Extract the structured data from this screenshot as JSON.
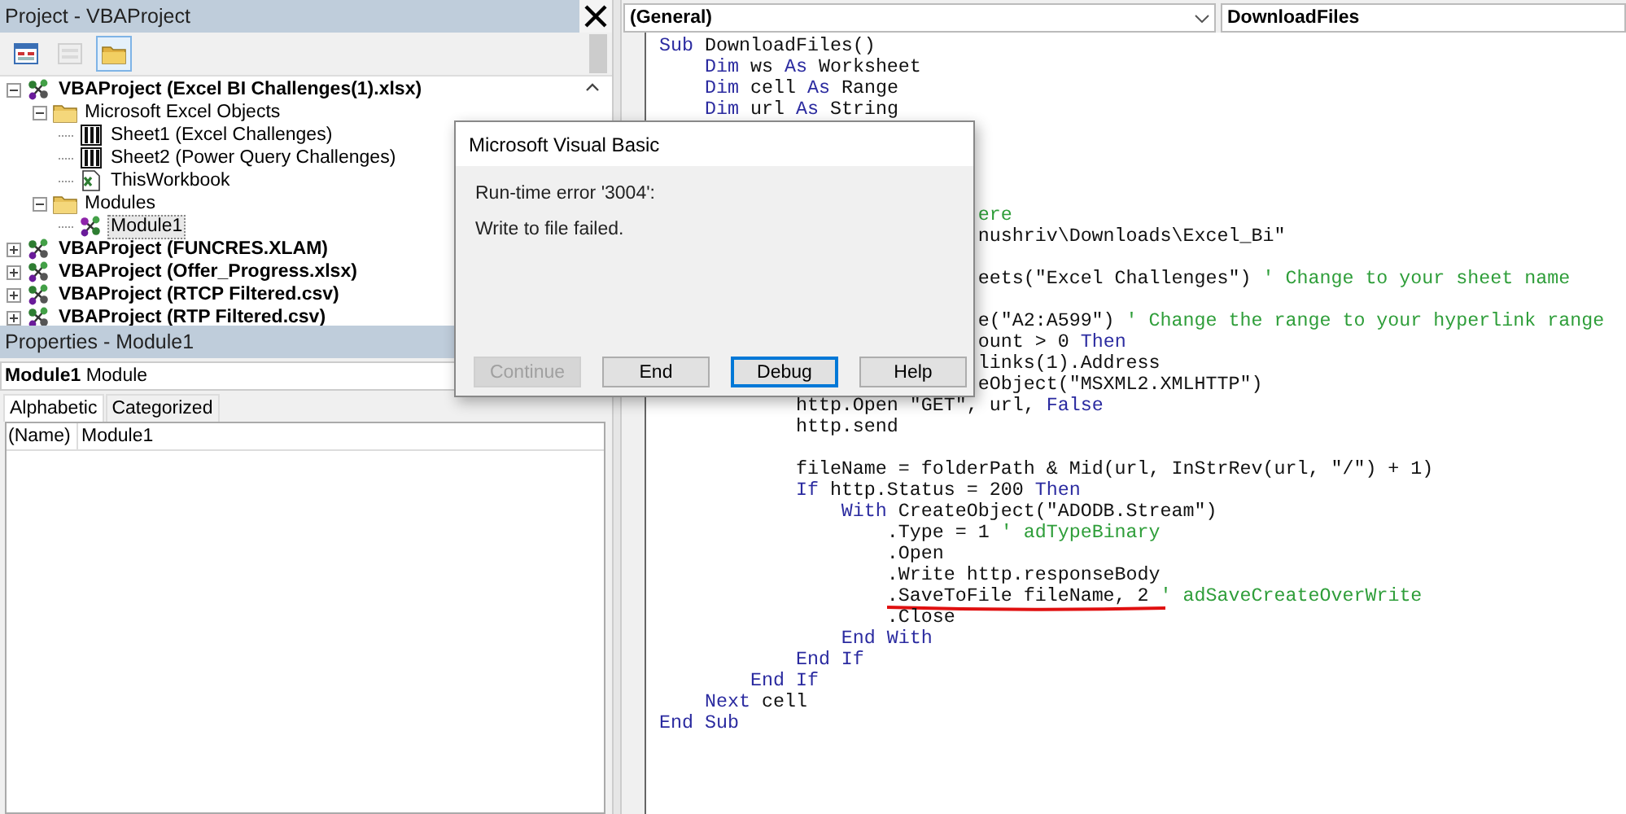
{
  "project_panel": {
    "title": "Project - VBAProject",
    "toolbar": [
      {
        "kind": "code",
        "selected": false,
        "disabled": false
      },
      {
        "kind": "object",
        "selected": false,
        "disabled": true
      },
      {
        "kind": "folders",
        "selected": true,
        "disabled": false
      }
    ],
    "tree": [
      {
        "kind": "project",
        "label": "VBAProject (Excel BI Challenges(1).xlsx)",
        "expanded": true,
        "selected": false,
        "children": [
          {
            "kind": "folder",
            "label": "Microsoft Excel Objects",
            "expanded": true,
            "selected": false,
            "children": [
              {
                "kind": "sheet",
                "label": "Sheet1 (Excel Challenges)",
                "selected": false
              },
              {
                "kind": "sheet",
                "label": "Sheet2 (Power Query Challenges)",
                "selected": false
              },
              {
                "kind": "workbook",
                "label": "ThisWorkbook",
                "selected": false
              }
            ]
          },
          {
            "kind": "folder",
            "label": "Modules",
            "expanded": true,
            "selected": false,
            "children": [
              {
                "kind": "module",
                "label": "Module1",
                "selected": true
              }
            ]
          }
        ]
      },
      {
        "kind": "project",
        "label": "VBAProject (FUNCRES.XLAM)",
        "expanded": false,
        "selected": false
      },
      {
        "kind": "project",
        "label": "VBAProject (Offer_Progress.xlsx)",
        "expanded": false,
        "selected": false
      },
      {
        "kind": "project",
        "label": "VBAProject (RTCP Filtered.csv)",
        "expanded": false,
        "selected": false
      },
      {
        "kind": "project",
        "label": "VBAProject (RTP Filtered.csv)",
        "expanded": false,
        "selected": false
      }
    ]
  },
  "properties_panel": {
    "title": "Properties - Module1",
    "object": "**Module1** Module",
    "tabs": [
      {
        "label": "Alphabetic",
        "selected": true
      },
      {
        "label": "Categorized",
        "selected": false
      }
    ],
    "rows": [
      {
        "name": "(Name)",
        "value": "Module1"
      }
    ]
  },
  "code_window": {
    "object_dropdown": "(General)",
    "procedure_dropdown": "DownloadFiles",
    "lines": [
      {
        "kind": "code",
        "marked": false,
        "segments": [
          {
            "kind": "keyword",
            "text": "Sub"
          },
          {
            "kind": "plain",
            "text": " DownloadFiles()"
          }
        ]
      },
      {
        "kind": "code",
        "marked": false,
        "segments": [
          {
            "kind": "keyword",
            "text": "    Dim"
          },
          {
            "kind": "plain",
            "text": " ws "
          },
          {
            "kind": "keyword",
            "text": "As"
          },
          {
            "kind": "plain",
            "text": " Worksheet"
          }
        ]
      },
      {
        "kind": "code",
        "marked": false,
        "segments": [
          {
            "kind": "keyword",
            "text": "    Dim"
          },
          {
            "kind": "plain",
            "text": " cell "
          },
          {
            "kind": "keyword",
            "text": "As"
          },
          {
            "kind": "plain",
            "text": " Range"
          }
        ]
      },
      {
        "kind": "code",
        "marked": false,
        "segments": [
          {
            "kind": "keyword",
            "text": "    Dim"
          },
          {
            "kind": "plain",
            "text": " url "
          },
          {
            "kind": "keyword",
            "text": "As"
          },
          {
            "kind": "plain",
            "text": " String"
          }
        ]
      },
      {
        "kind": "blank"
      },
      {
        "kind": "blank"
      },
      {
        "kind": "blank"
      },
      {
        "kind": "blank"
      },
      {
        "kind": "code",
        "marked": false,
        "segments": [
          {
            "kind": "comment",
            "text": "                            ere"
          }
        ]
      },
      {
        "kind": "code",
        "marked": false,
        "segments": [
          {
            "kind": "plain",
            "text": "                            nushriv\\Downloads\\Excel_Bi\""
          }
        ]
      },
      {
        "kind": "blank"
      },
      {
        "kind": "code",
        "marked": false,
        "segments": [
          {
            "kind": "plain",
            "text": "                            eets(\"Excel Challenges\") "
          },
          {
            "kind": "comment",
            "text": "' Change to your sheet name"
          }
        ]
      },
      {
        "kind": "blank"
      },
      {
        "kind": "code",
        "marked": false,
        "segments": [
          {
            "kind": "plain",
            "text": "                            e(\"A2:A599\") "
          },
          {
            "kind": "comment",
            "text": "' Change the range to your hyperlink range"
          }
        ]
      },
      {
        "kind": "code",
        "marked": false,
        "segments": [
          {
            "kind": "plain",
            "text": "                            ount > 0 "
          },
          {
            "kind": "keyword",
            "text": "Then"
          }
        ]
      },
      {
        "kind": "code",
        "marked": false,
        "segments": [
          {
            "kind": "plain",
            "text": "                            links(1).Address"
          }
        ]
      },
      {
        "kind": "code",
        "marked": false,
        "segments": [
          {
            "kind": "plain",
            "text": "                            eObject(\"MSXML2.XMLHTTP\")"
          }
        ]
      },
      {
        "kind": "code",
        "marked": false,
        "segments": [
          {
            "kind": "plain",
            "text": "            http.Open \"GET\", url, "
          },
          {
            "kind": "keyword",
            "text": "False"
          }
        ]
      },
      {
        "kind": "code",
        "marked": false,
        "segments": [
          {
            "kind": "plain",
            "text": "            http.send"
          }
        ]
      },
      {
        "kind": "blank"
      },
      {
        "kind": "code",
        "marked": false,
        "segments": [
          {
            "kind": "plain",
            "text": "            fileName = folderPath & Mid(url, InStrRev(url, \"/\") + 1)"
          }
        ]
      },
      {
        "kind": "code",
        "marked": false,
        "segments": [
          {
            "kind": "keyword",
            "text": "            If"
          },
          {
            "kind": "plain",
            "text": " http.Status = 200 "
          },
          {
            "kind": "keyword",
            "text": "Then"
          }
        ]
      },
      {
        "kind": "code",
        "marked": false,
        "segments": [
          {
            "kind": "keyword",
            "text": "                With"
          },
          {
            "kind": "plain",
            "text": " CreateObject(\"ADODB.Stream\")"
          }
        ]
      },
      {
        "kind": "code",
        "marked": false,
        "segments": [
          {
            "kind": "plain",
            "text": "                    .Type = 1 "
          },
          {
            "kind": "comment",
            "text": "' adTypeBinary"
          }
        ]
      },
      {
        "kind": "code",
        "marked": false,
        "segments": [
          {
            "kind": "plain",
            "text": "                    .Open"
          }
        ]
      },
      {
        "kind": "code",
        "marked": false,
        "segments": [
          {
            "kind": "plain",
            "text": "                    .Write http.responseBody"
          }
        ]
      },
      {
        "kind": "code",
        "marked": true,
        "segments": [
          {
            "kind": "plain",
            "text": "                    .SaveToFile fileName, 2 "
          },
          {
            "kind": "comment",
            "text": "' adSaveCreateOverWrite"
          }
        ]
      },
      {
        "kind": "code",
        "marked": false,
        "segments": [
          {
            "kind": "plain",
            "text": "                    .Close"
          }
        ]
      },
      {
        "kind": "code",
        "marked": false,
        "segments": [
          {
            "kind": "keyword",
            "text": "                End With"
          }
        ]
      },
      {
        "kind": "code",
        "marked": false,
        "segments": [
          {
            "kind": "keyword",
            "text": "            End If"
          }
        ]
      },
      {
        "kind": "code",
        "marked": false,
        "segments": [
          {
            "kind": "keyword",
            "text": "        End If"
          }
        ]
      },
      {
        "kind": "code",
        "marked": false,
        "segments": [
          {
            "kind": "keyword",
            "text": "    Next"
          },
          {
            "kind": "plain",
            "text": " cell"
          }
        ]
      },
      {
        "kind": "code",
        "marked": false,
        "segments": [
          {
            "kind": "keyword",
            "text": "End Sub"
          }
        ]
      }
    ]
  },
  "dialog": {
    "title": "Microsoft Visual Basic",
    "messages": [
      "Run-time error '3004':",
      "Write to file failed."
    ],
    "buttons": [
      {
        "label": "Continue",
        "disabled": true,
        "focused": false
      },
      {
        "label": "End",
        "disabled": false,
        "focused": false
      },
      {
        "label": "Debug",
        "disabled": false,
        "focused": true
      },
      {
        "label": "Help",
        "disabled": false,
        "focused": false
      }
    ]
  }
}
